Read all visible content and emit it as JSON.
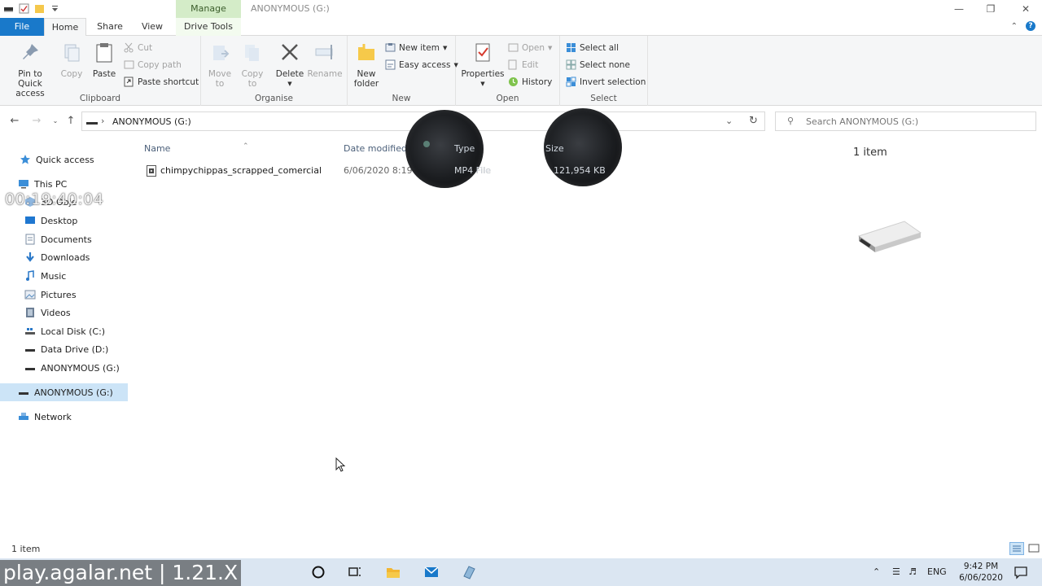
{
  "window": {
    "title": "ANONYMOUS (G:)",
    "context_tab": "Manage"
  },
  "ribbon_tabs": {
    "file": "File",
    "home": "Home",
    "share": "Share",
    "view": "View",
    "drive_tools": "Drive Tools"
  },
  "clipboard": {
    "label": "Clipboard",
    "pin_line1": "Pin to Quick",
    "pin_line2": "access",
    "copy": "Copy",
    "paste": "Paste",
    "cut": "Cut",
    "copy_path": "Copy path",
    "paste_shortcut": "Paste shortcut"
  },
  "organise": {
    "label": "Organise",
    "move_line1": "Move",
    "move_line2": "to",
    "copy_line1": "Copy",
    "copy_line2": "to",
    "delete": "Delete",
    "rename": "Rename"
  },
  "new_group": {
    "label": "New",
    "new_folder_line1": "New",
    "new_folder_line2": "folder",
    "new_item": "New item",
    "easy_access": "Easy access"
  },
  "open_group": {
    "label": "Open",
    "properties": "Properties",
    "open": "Open",
    "edit": "Edit",
    "history": "History"
  },
  "select_group": {
    "label": "Select",
    "select_all": "Select all",
    "select_none": "Select none",
    "invert": "Invert selection"
  },
  "address": {
    "path": "ANONYMOUS (G:)",
    "search_placeholder": "Search ANONYMOUS (G:)"
  },
  "nav": {
    "quick_access": "Quick access",
    "this_pc": "This PC",
    "objects_partial": "3D Obje",
    "desktop": "Desktop",
    "documents": "Documents",
    "downloads": "Downloads",
    "music": "Music",
    "pictures": "Pictures",
    "videos": "Videos",
    "local_disk": "Local Disk (C:)",
    "data_drive": "Data Drive (D:)",
    "anonymous_sub": "ANONYMOUS (G:)",
    "anonymous": "ANONYMOUS (G:)",
    "network": "Network"
  },
  "columns": {
    "name": "Name",
    "date_modified": "Date modified",
    "type": "Type",
    "size": "Size"
  },
  "files": [
    {
      "name": "chimpychippas_scrapped_comercial",
      "date": "6/06/2020 8:19 PM",
      "type": "MP4 File",
      "size": "121,954 KB"
    }
  ],
  "preview": {
    "count": "1 item"
  },
  "status": {
    "count": "1 item"
  },
  "taskbar": {
    "lang": "ENG",
    "time": "9:42 PM",
    "date": "6/06/2020"
  },
  "overlays": {
    "timestamp": "00:19:40:04",
    "banner": "play.agalar.net | 1.21.X"
  },
  "colors": {
    "accent": "#1979ca",
    "manage_tab": "#d4ecc8",
    "selection": "#cce4f7",
    "taskbar": "#dbe6f2"
  }
}
